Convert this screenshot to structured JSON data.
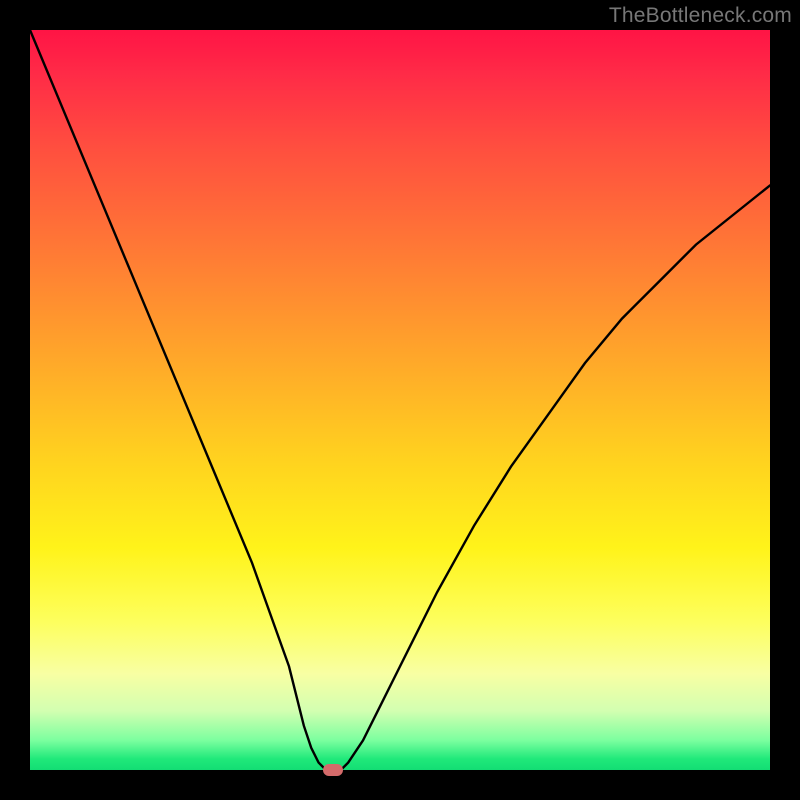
{
  "watermark": "TheBottleneck.com",
  "chart_data": {
    "type": "line",
    "title": "",
    "xlabel": "",
    "ylabel": "",
    "xlim": [
      0,
      100
    ],
    "ylim": [
      0,
      100
    ],
    "grid": false,
    "legend": false,
    "series": [
      {
        "name": "bottleneck-curve",
        "x": [
          0,
          5,
          10,
          15,
          20,
          25,
          30,
          35,
          37,
          38,
          39,
          40,
          41,
          42,
          43,
          45,
          50,
          55,
          60,
          65,
          70,
          75,
          80,
          85,
          90,
          95,
          100
        ],
        "y": [
          100,
          88,
          76,
          64,
          52,
          40,
          28,
          14,
          6,
          3,
          1,
          0,
          0,
          0,
          1,
          4,
          14,
          24,
          33,
          41,
          48,
          55,
          61,
          66,
          71,
          75,
          79
        ]
      }
    ],
    "minimum_marker": {
      "x": 41,
      "y": 0
    },
    "colors": {
      "curve": "#000000",
      "marker": "#d46a6a",
      "frame": "#000000",
      "gradient_top": "#ff1445",
      "gradient_bottom": "#13dd74"
    }
  }
}
